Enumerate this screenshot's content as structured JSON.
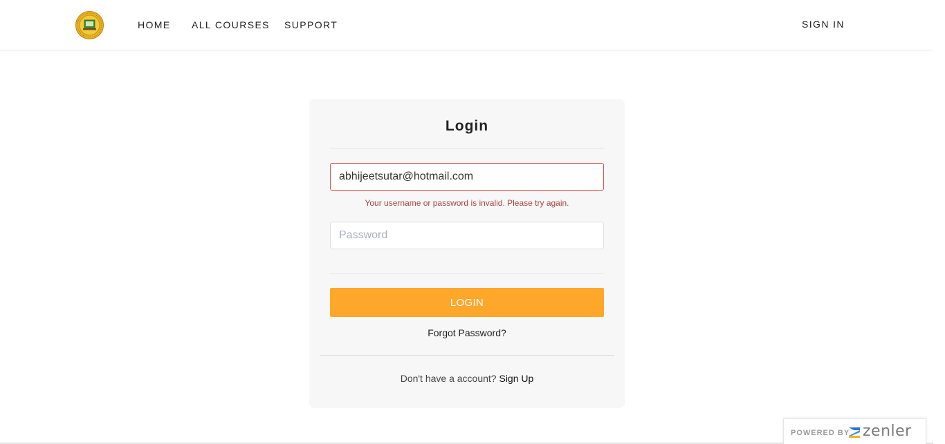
{
  "nav": {
    "home": "HOME",
    "all_courses": "ALL COURSES",
    "support": "SUPPORT",
    "sign_in": "SIGN IN"
  },
  "login": {
    "title": "Login",
    "email_value": "abhijeetsutar@hotmail.com",
    "error_message": "Your username or password is invalid. Please try again.",
    "password_placeholder": "Password",
    "submit_label": "LOGIN",
    "forgot_label": "Forgot Password?",
    "signup_prompt": "Don't have a account?",
    "signup_label": "Sign Up"
  },
  "footer": {
    "powered_by": "POWERED BY",
    "brand": "zenler"
  },
  "colors": {
    "accent": "#ffa72b",
    "error": "#a94442",
    "card_bg": "#f7f7f7"
  },
  "icons": {
    "logo": "school-emblem-icon",
    "brand": "zenler-z-icon"
  }
}
